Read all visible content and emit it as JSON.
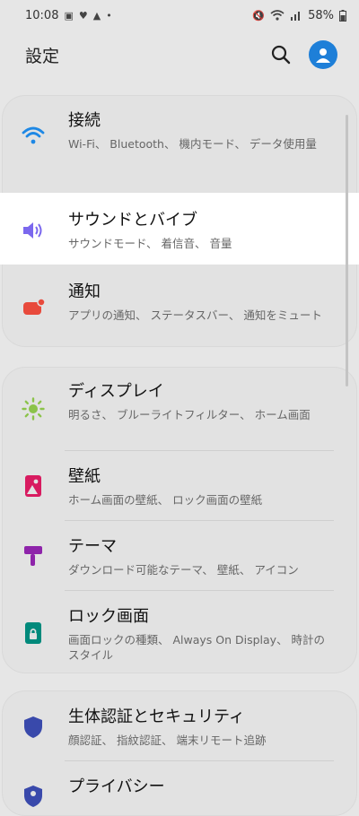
{
  "status_bar": {
    "time": "10:08",
    "battery": "58%"
  },
  "header": {
    "title": "設定"
  },
  "settings": [
    {
      "title": "接続",
      "subtitle": "Wi-Fi、 Bluetooth、 機内モード、 データ使用量"
    },
    {
      "title": "サウンドとバイブ",
      "subtitle": "サウンドモード、 着信音、 音量"
    },
    {
      "title": "通知",
      "subtitle": "アプリの通知、 ステータスバー、 通知をミュート"
    },
    {
      "title": "ディスプレイ",
      "subtitle": "明るさ、 ブルーライトフィルター、 ホーム画面"
    },
    {
      "title": "壁紙",
      "subtitle": "ホーム画面の壁紙、 ロック画面の壁紙"
    },
    {
      "title": "テーマ",
      "subtitle": "ダウンロード可能なテーマ、 壁紙、 アイコン"
    },
    {
      "title": "ロック画面",
      "subtitle": "画面ロックの種類、 Always On Display、 時計のスタイル"
    },
    {
      "title": "生体認証とセキュリティ",
      "subtitle": "顔認証、 指紋認証、 端末リモート追跡"
    },
    {
      "title": "プライバシー",
      "subtitle": ""
    }
  ],
  "colors": {
    "accent": "#1e7fd8",
    "wifi": "#1e88e5",
    "sound": "#7b68ee",
    "notify": "#e84a3c",
    "display": "#8bc34a",
    "wallpaper": "#d81b60",
    "theme": "#8e24aa",
    "lock": "#00897b",
    "security": "#3949ab"
  }
}
